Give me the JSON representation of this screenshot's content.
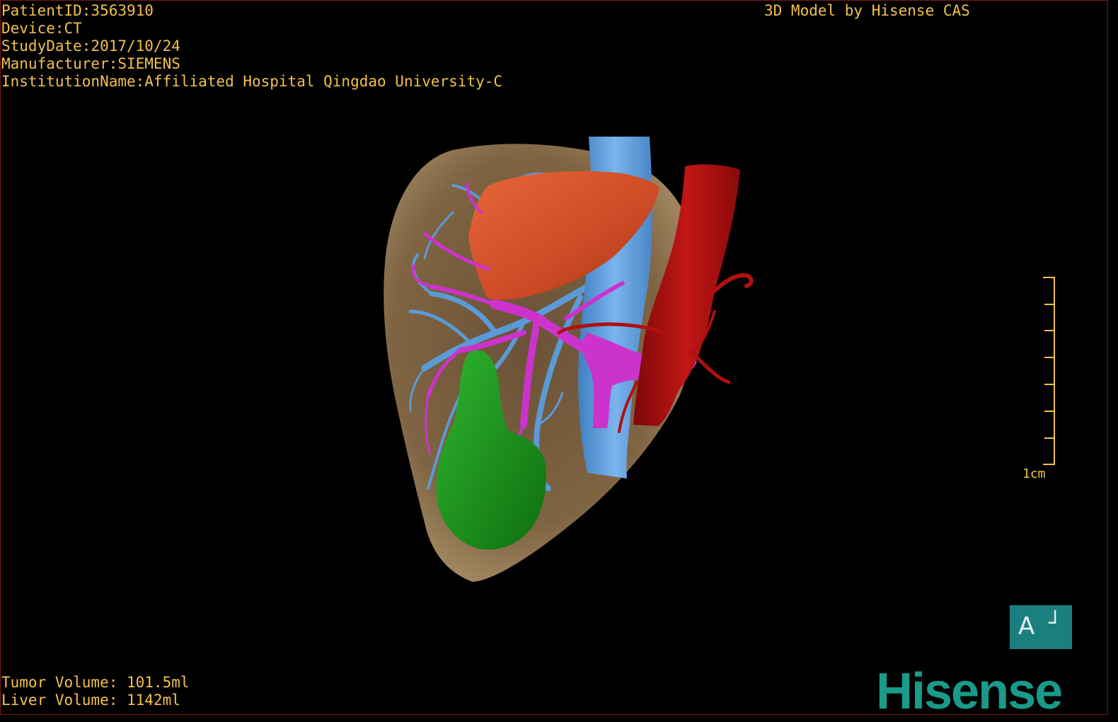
{
  "header": {
    "patient_id": "PatientID:3563910",
    "device": "Device:CT",
    "study_date": "StudyDate:2017/10/24",
    "manufacturer": "Manufacturer:SIEMENS",
    "institution": "InstitutionName:Affiliated Hospital Qingdao University-C",
    "model_by": "3D Model by Hisense CAS"
  },
  "volumes": {
    "tumor": "Tumor Volume: 101.5ml",
    "liver": "Liver Volume: 1142ml"
  },
  "scale_bar": {
    "label": "1cm"
  },
  "orientation": {
    "letter": "A",
    "corner_glyph": "┘"
  },
  "brand": {
    "logo_text": "Hisense"
  },
  "colors": {
    "overlay_text": "#f2c14e",
    "liver": "#7a6040",
    "portal_vein": "#cc33cc",
    "hepatic_vein": "#5a9ad6",
    "artery": "#b01010",
    "tumor_orange": "#d8552e",
    "tumor_green": "#1a8c1a",
    "brand_teal": "#1a9a8a",
    "orient_box": "#1a7f7f"
  }
}
